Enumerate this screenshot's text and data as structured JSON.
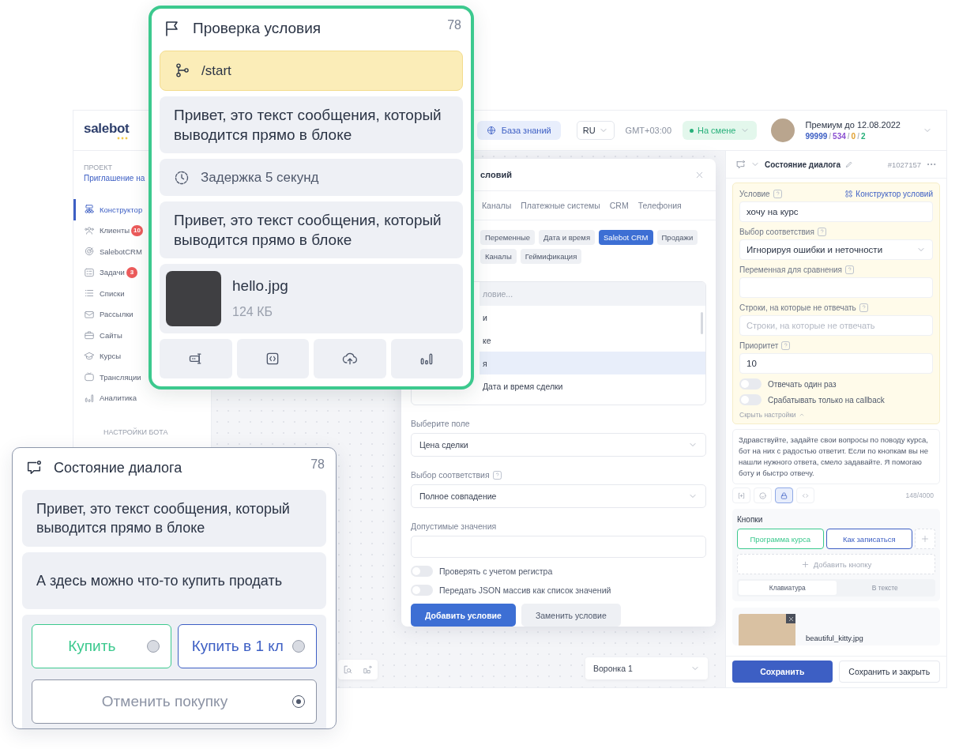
{
  "header": {
    "logo": "salebot",
    "knowledge_base": "База знаний",
    "language": "RU",
    "timezone": "GMT+03:00",
    "status": "На смене",
    "plan": "Премиум до 12.08.2022",
    "counter_separator": "/",
    "counters": [
      {
        "text": "99999",
        "color": "#3d5fc4"
      },
      {
        "text": "534",
        "color": "#8a4fd0"
      },
      {
        "text": "0",
        "color": "#e0a030"
      },
      {
        "text": "2",
        "color": "#27b07a"
      }
    ]
  },
  "sidebar": {
    "project_label": "ПРОЕКТ",
    "project_name": "Приглашение на",
    "section": "НАСТРОЙКИ БОТА",
    "items": [
      {
        "label": "Конструктор",
        "selected": true
      },
      {
        "label": "Клиенты",
        "badge": "10",
        "selected": false
      },
      {
        "label": "SalebotCRM",
        "selected": false
      },
      {
        "label": "Задачи",
        "badge": "3",
        "selected": false
      },
      {
        "label": "Списки",
        "selected": false
      },
      {
        "label": "Рассылки",
        "selected": false
      },
      {
        "label": "Сайты",
        "selected": false
      },
      {
        "label": "Курсы",
        "selected": false
      },
      {
        "label": "Трансляции",
        "selected": false
      },
      {
        "label": "Аналитика",
        "selected": false
      }
    ]
  },
  "dialog": {
    "title": "словий",
    "tabs": [
      {
        "label": "Каналы",
        "selected": false
      },
      {
        "label": "Платежные системы",
        "selected": false
      },
      {
        "label": "CRM",
        "selected": false
      },
      {
        "label": "Телефония",
        "selected": false
      }
    ],
    "chips": [
      {
        "label": "Переменные",
        "selected": false
      },
      {
        "label": "Дата и время",
        "selected": false
      },
      {
        "label": "Salebot CRM",
        "selected": true
      },
      {
        "label": "Продажи",
        "selected": false
      },
      {
        "label": "Каналы",
        "selected": false
      },
      {
        "label": "Геймификация",
        "selected": false
      }
    ],
    "search_placeholder": "ловие...",
    "list": [
      {
        "label": "и",
        "selected": false
      },
      {
        "label": "ке",
        "selected": false
      },
      {
        "label": "я",
        "selected": true
      },
      {
        "label": "Дата и время сделки",
        "selected": false
      }
    ],
    "field_label": "Выберите поле",
    "field_value": "Цена сделки",
    "match_label": "Выбор соответствия",
    "match_value": "Полное совпадение",
    "allowed_label": "Допустимые значения",
    "toggles": [
      {
        "label": "Проверять с учетом регистра",
        "on": false
      },
      {
        "label": "Передать JSON массив как список значений",
        "on": false
      }
    ],
    "primary_button": "Добавить условие",
    "secondary_button": "Заменить условие"
  },
  "canvas": {
    "funnel": "Воронка 1"
  },
  "panel": {
    "title": "Состояние диалога",
    "id": "#1027157",
    "condition_label": "Условие",
    "constructor_link": "Конструктор условий",
    "condition_value": "хочу на курс",
    "match_label": "Выбор соответствия",
    "match_value": "Игнорируя ошибки и неточности",
    "variable_label": "Переменная для сравнения",
    "skip_label": "Строки, на которые не отвечать",
    "skip_placeholder": "Строки, на которые не отвечать",
    "priority_label": "Приоритет",
    "priority_value": "10",
    "toggles": [
      {
        "label": "Отвечать один раз",
        "on": false
      },
      {
        "label": "Срабатывать только на callback",
        "on": false
      }
    ],
    "hide_settings": "Скрыть настройки",
    "message": "Здравствуйте, задайте свои вопросы по поводу курса, бот на них с радостью ответит. Если по кнопкам вы не нашли нужного ответа, смело задавайте. Я помогаю боту и быстро отвечу.",
    "tools": [
      {
        "selected": false
      },
      {
        "selected": false
      },
      {
        "selected": true
      },
      {
        "selected": false
      }
    ],
    "counter": "148/4000",
    "buttons_title": "Кнопки",
    "buttons": [
      {
        "label": "Программа курса",
        "color": "#3cc98e"
      },
      {
        "label": "Как записаться",
        "color": "#3d5fc4"
      }
    ],
    "add_button": "Добавить кнопку",
    "modes": [
      {
        "label": "Клавиатура",
        "selected": true
      },
      {
        "label": "В тексте",
        "selected": false
      }
    ],
    "attachment": "beautiful_kitty.jpg",
    "save": "Сохранить",
    "save_close": "Сохранить и закрыть"
  },
  "card_top": {
    "title": "Проверка условия",
    "number": "78",
    "blocks": [
      {
        "kind": "trigger",
        "text": "/start"
      },
      {
        "kind": "message",
        "text": "Привет, это текст сообщения, который выводится прямо в блоке"
      },
      {
        "kind": "delay",
        "text": "Задержка 5 секунд"
      },
      {
        "kind": "message",
        "text": "Привет, это текст сообщения, который выводится прямо в блоке"
      },
      {
        "kind": "file",
        "name": "hello.jpg",
        "size": "124 КБ"
      }
    ]
  },
  "card_bottom": {
    "title": "Состояние диалога",
    "number": "78",
    "messages": [
      "Привет, это текст сообщения, который выводится прямо в блоке",
      "А здесь можно что-то купить продать"
    ],
    "buttons": [
      {
        "label": "Купить",
        "color": "#3cc98e",
        "selected": false
      },
      {
        "label": "Купить в 1 кл",
        "color": "#3d5fc4",
        "selected": false
      },
      {
        "label": "Отменить покупку",
        "color": "#8d94a5",
        "selected": true
      }
    ]
  }
}
